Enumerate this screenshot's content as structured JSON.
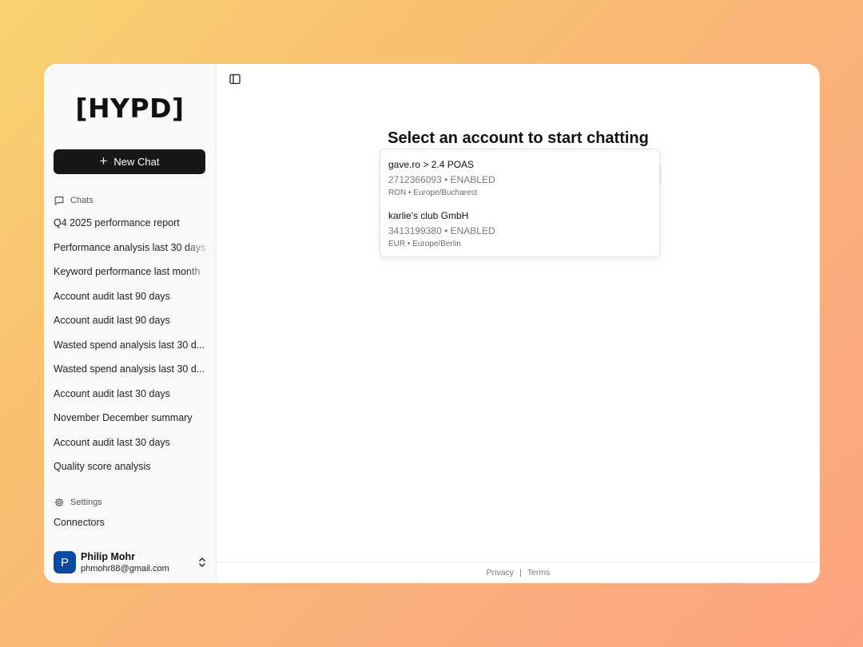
{
  "app": {
    "logo": "[HYPD]"
  },
  "sidebar": {
    "new_chat_label": "New Chat",
    "chats_heading": "Chats",
    "chats": [
      "Q4 2025 performance report",
      "Performance analysis last 30 days",
      "Keyword performance last month",
      "Account audit last 90 days",
      "Account audit last 90 days",
      "Wasted spend analysis last 30 d...",
      "Wasted spend analysis last 30 d...",
      "Account audit last 30 days",
      "November December summary",
      "Account audit last 30 days",
      "Quality score analysis"
    ],
    "settings_heading": "Settings",
    "connectors_label": "Connectors",
    "user": {
      "initial": "P",
      "name": "Philip Mohr",
      "email": "phmohr88@gmail.com"
    }
  },
  "main": {
    "title": "Select an account to start chatting",
    "accounts": [
      {
        "name": "gave.ro > 2.4 POAS",
        "id_status": "2712366093 • ENABLED",
        "meta": "RON • Europe/Bucharest"
      },
      {
        "name": "karlie's club GmbH",
        "id_status": "3413199380 • ENABLED",
        "meta": "EUR • Europe/Berlin"
      }
    ]
  },
  "footer": {
    "privacy": "Privacy",
    "separator": "|",
    "terms": "Terms"
  },
  "colors": {
    "accent_button": "#171717",
    "avatar": "#0b4aa0"
  },
  "icons": {
    "new_chat": "plus-icon",
    "chats": "chat-bubble-icon",
    "settings": "gear-icon",
    "user_menu": "chevron-up-down-icon",
    "sidebar_toggle": "sidebar-panel-icon"
  }
}
